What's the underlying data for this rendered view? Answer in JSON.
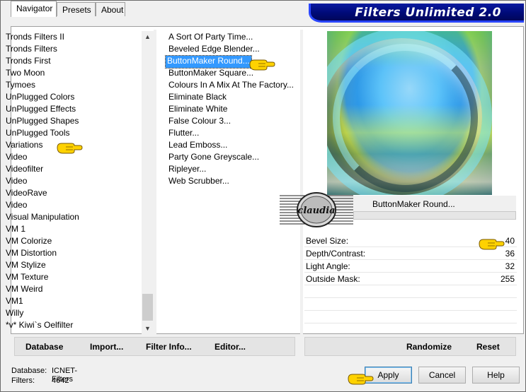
{
  "window": {
    "title": "Filters Unlimited 2.0"
  },
  "tabs": [
    {
      "label": "Navigator",
      "active": true
    },
    {
      "label": "Presets",
      "active": false
    },
    {
      "label": "About",
      "active": false
    }
  ],
  "categories": [
    "Tronds Filters II",
    "Tronds Filters",
    "Tronds First",
    "Two Moon",
    "Tymoes",
    "UnPlugged Colors",
    "UnPlugged Effects",
    "UnPlugged Shapes",
    "UnPlugged Tools",
    "Variations",
    "Video",
    "Videofilter",
    "Video",
    "VideoRave",
    "Video",
    "Visual Manipulation",
    "VM 1",
    "VM Colorize",
    "VM Distortion",
    "VM Stylize",
    "VM Texture",
    "VM Weird",
    "VM1",
    "Willy",
    "*v* Kiwi`s Oelfilter"
  ],
  "filters": [
    "A Sort Of Party Time...",
    "Beveled Edge Blender...",
    "ButtonMaker Round...",
    "ButtonMaker Square...",
    "Colours In A Mix At The Factory...",
    "Eliminate Black",
    "Eliminate White",
    "False Colour 3...",
    "Flutter...",
    "Lead Emboss...",
    "Party Gone Greyscale...",
    "Ripleyer...",
    "Web Scrubber..."
  ],
  "selected_filter": "ButtonMaker Round...",
  "watermark_text": "claudia",
  "params": [
    {
      "label": "Bevel Size:",
      "value": "40"
    },
    {
      "label": "Depth/Contrast:",
      "value": "36"
    },
    {
      "label": "Light Angle:",
      "value": "32"
    },
    {
      "label": "Outside Mask:",
      "value": "255"
    }
  ],
  "toolbar": {
    "database_label": "Database",
    "import_label": "Import...",
    "filter_info_label": "Filter Info...",
    "editor_label": "Editor...",
    "randomize_label": "Randomize",
    "reset_label": "Reset"
  },
  "status": {
    "database_label": "Database:",
    "database_value": "ICNET-Filters",
    "filters_label": "Filters:",
    "filters_value": "4642"
  },
  "buttons": {
    "apply": "Apply",
    "cancel": "Cancel",
    "help": "Help"
  },
  "colors": {
    "title_bg": "#000a78",
    "title_border": "#2a46ff",
    "selection": "#3399ff",
    "pointer_hand": "#ffd200"
  }
}
